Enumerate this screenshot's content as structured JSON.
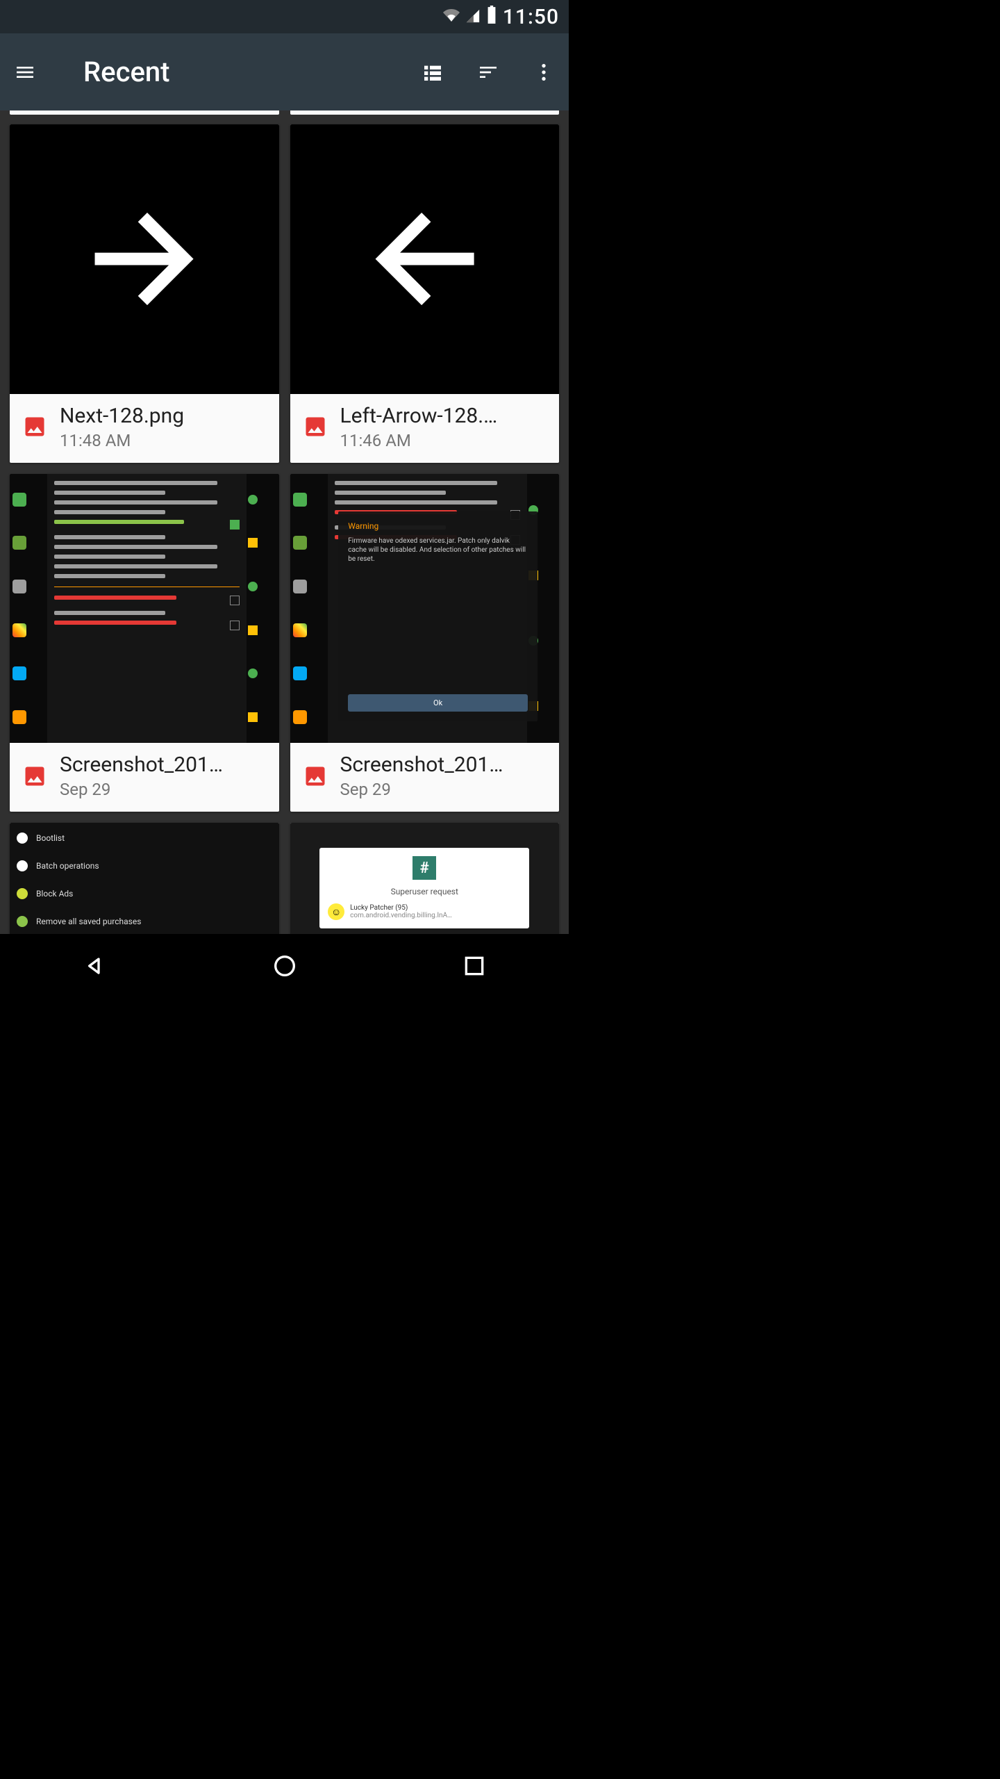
{
  "status": {
    "time": "11:50"
  },
  "appbar": {
    "title": "Recent"
  },
  "files": [
    {
      "name": "Next-128.png",
      "date": "11:48 AM"
    },
    {
      "name": "Left-Arrow-128.…",
      "date": "11:46 AM"
    },
    {
      "name": "Screenshot_201…",
      "date": "Sep 29"
    },
    {
      "name": "Screenshot_201…",
      "date": "Sep 29"
    }
  ],
  "thumb_text": {
    "warning_title": "Warning",
    "warning_body": "Firmware have odexed services.jar. Patch only dalvik cache will be disabled. And selection of other patches will be reset.",
    "ok": "Ok",
    "list_items": [
      "Bootlist",
      "Batch operations",
      "Block Ads",
      "Remove all saved purchases"
    ],
    "su_request": "Superuser request",
    "su_app": "Lucky Patcher (95)",
    "su_pkg": "com.android.vending.billing.InA…"
  }
}
